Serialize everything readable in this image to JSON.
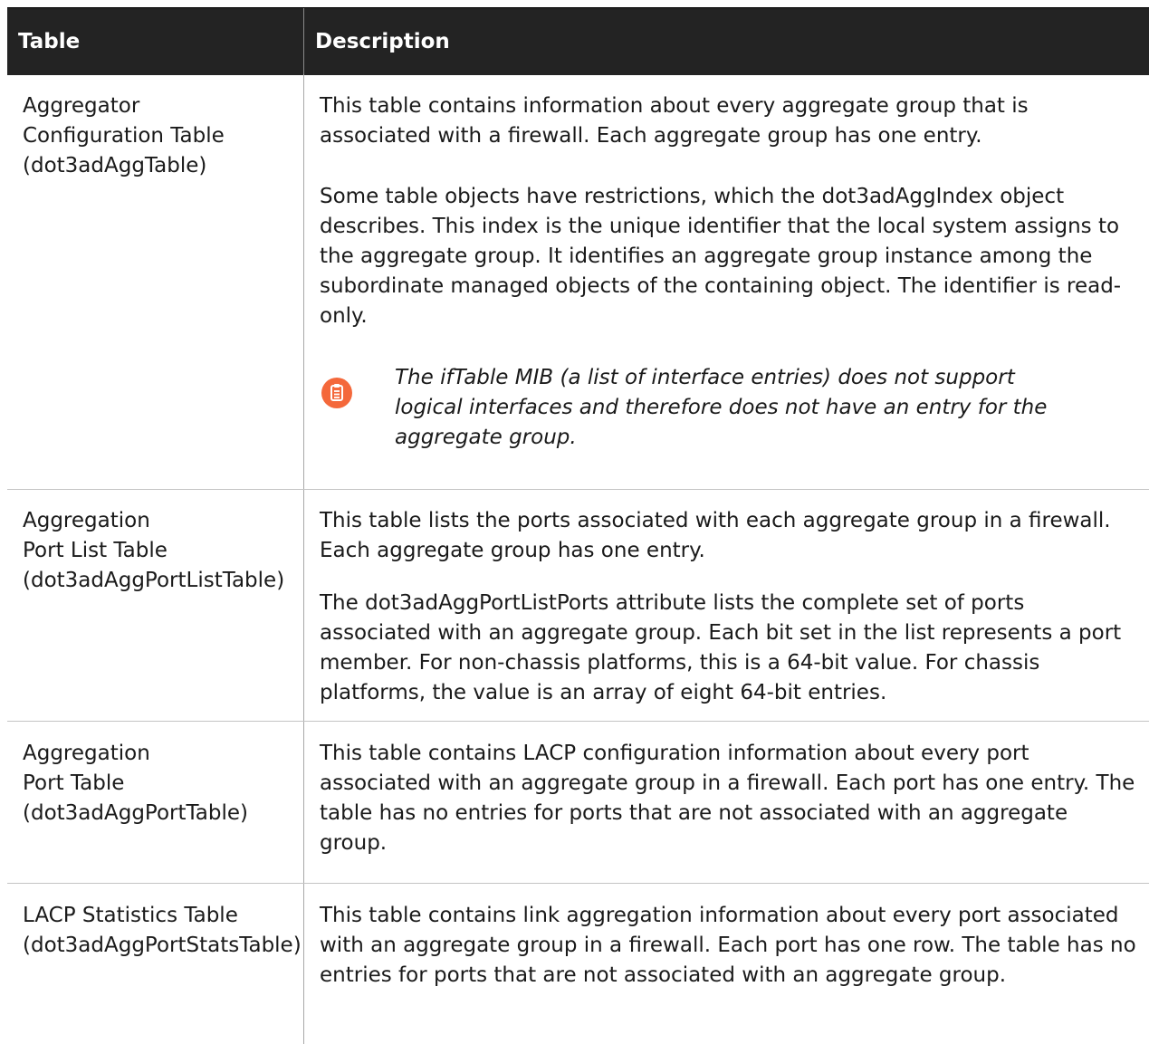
{
  "header": {
    "col1": "Table",
    "col2": "Description"
  },
  "rows": [
    {
      "name_lines": [
        "Aggregator",
        "Configuration Table",
        "(dot3adAggTable)"
      ],
      "paragraphs": [
        "This table contains information about every aggregate group that is associated with a firewall. Each aggregate group has one entry.",
        "Some table objects have restrictions, which the dot3adAggIndex object describes. This index is the unique identifier that the local system assigns to the aggregate group. It identifies an aggregate group instance among the subordinate managed objects of the containing object. The identifier is read-only."
      ],
      "note": {
        "icon": "note-clipboard-icon",
        "text": "The ifTable MIB (a list of interface entries) does not support logical interfaces and therefore does not have an entry for the aggregate group."
      }
    },
    {
      "name_lines": [
        "Aggregation",
        "Port List Table",
        "(dot3adAggPortListTable)"
      ],
      "paragraphs": [
        "This table lists the ports associated with each aggregate group in a firewall. Each aggregate group has one entry.",
        "The dot3adAggPortListPorts attribute lists the complete set of ports associated with an aggregate group. Each bit set in the list represents a port member. For non-chassis platforms, this is a 64-bit value. For chassis platforms, the value is an array of eight 64-bit entries."
      ]
    },
    {
      "name_lines": [
        "Aggregation",
        "Port Table",
        "(dot3adAggPortTable)"
      ],
      "paragraphs": [
        "This table contains LACP configuration information about every port associated with an aggregate group in a firewall. Each port has one entry. The table has no entries for ports that are not associated with an aggregate group."
      ]
    },
    {
      "name_lines": [
        "LACP Statistics Table",
        "(dot3adAggPortStatsTable)"
      ],
      "paragraphs": [
        "This table contains link aggregation information about every port associated with an aggregate group in a firewall. Each port has one row. The table has no entries for ports that are not associated with an aggregate group."
      ]
    }
  ],
  "colors": {
    "header_bg": "#232323",
    "header_text": "#ffffff",
    "note_icon": "#f4683b",
    "text": "#1a1a1a"
  }
}
